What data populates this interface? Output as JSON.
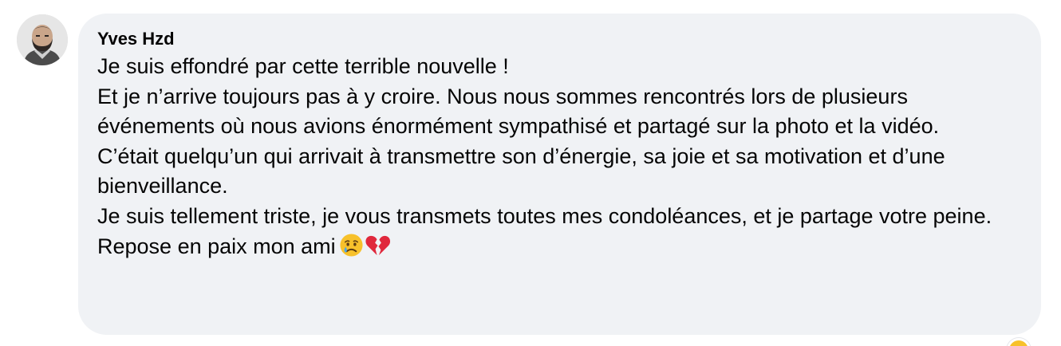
{
  "comment": {
    "author": "Yves Hzd",
    "lines": [
      "Je suis effondré par cette terrible nouvelle !",
      "Et je n’arrive toujours pas à y croire. Nous nous sommes rencontrés lors de plusieurs événements où nous avions énormément sympathisé et partagé sur la photo et la vidéo.",
      "C’était quelqu’un qui arrivait à transmettre son d’énergie, sa joie et sa motivation et d’une bienveillance.",
      "Je suis tellement triste, je vous transmets toutes mes condoléances, et je partage votre peine.",
      "Repose en paix mon ami"
    ],
    "trailing_emojis": [
      "crying-face-emoji",
      "broken-heart-emoji"
    ]
  },
  "colors": {
    "bubble_bg": "#f0f2f5",
    "text": "#050505",
    "emoji_face": "#f7c12b",
    "emoji_tear": "#4aa6e8",
    "broken_heart": "#e0283c"
  }
}
